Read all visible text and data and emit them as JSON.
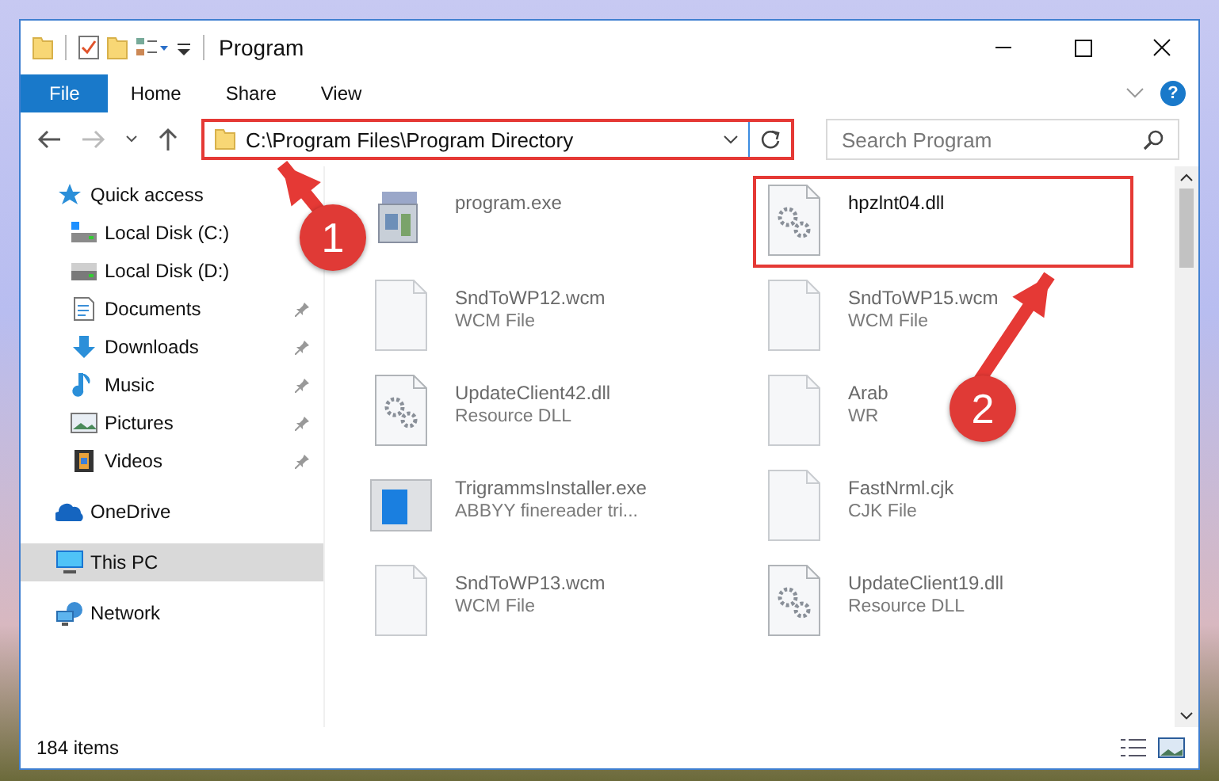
{
  "window": {
    "title": "Program"
  },
  "ribbon": {
    "tabs": [
      {
        "label": "File",
        "kind": "menu"
      },
      {
        "label": "Home",
        "kind": "tab"
      },
      {
        "label": "Share",
        "kind": "tab"
      },
      {
        "label": "View",
        "kind": "tab"
      }
    ],
    "help": "?"
  },
  "address": {
    "path": "C:\\Program Files\\Program Directory",
    "highlighted": true
  },
  "search": {
    "placeholder": "Search Program"
  },
  "sidebar": {
    "items": [
      {
        "label": "Quick access",
        "selected": false,
        "children": [
          {
            "label": "Local Disk (C:)",
            "pinned": false,
            "selected": false
          },
          {
            "label": "Local Disk (D:)",
            "pinned": false,
            "selected": false
          },
          {
            "label": "Documents",
            "pinned": true,
            "selected": false
          },
          {
            "label": "Downloads",
            "pinned": true,
            "selected": false
          },
          {
            "label": "Music",
            "pinned": true,
            "selected": false
          },
          {
            "label": "Pictures",
            "pinned": true,
            "selected": false
          },
          {
            "label": "Videos",
            "pinned": true,
            "selected": false
          }
        ]
      },
      {
        "label": "OneDrive",
        "selected": false
      },
      {
        "label": "This PC",
        "selected": true
      },
      {
        "label": "Network",
        "selected": false
      }
    ]
  },
  "files": [
    {
      "name": "program.exe",
      "kind": "exe",
      "highlighted": false
    },
    {
      "name": "hpzlnt04.dll",
      "kind": "dll",
      "highlighted": true
    },
    {
      "name": "SndToWP12.wcm",
      "type": "WCM File",
      "kind": "blank",
      "highlighted": false
    },
    {
      "name": "SndToWP15.wcm",
      "type": "WCM File",
      "kind": "blank",
      "highlighted": false
    },
    {
      "name": "UpdateClient42.dll",
      "type": "Resource DLL",
      "kind": "dll",
      "highlighted": false
    },
    {
      "name": "Arab",
      "type": "WR",
      "kind": "blank",
      "highlighted": false
    },
    {
      "name": "TrigrammsInstaller.exe",
      "type": "ABBYY finereader tri...",
      "kind": "installer",
      "highlighted": false
    },
    {
      "name": "FastNrml.cjk",
      "type": "CJK File",
      "kind": "blank",
      "highlighted": false
    },
    {
      "name": "SndToWP13.wcm",
      "type": "WCM File",
      "kind": "blank",
      "highlighted": false
    },
    {
      "name": "UpdateClient19.dll",
      "type": "Resource DLL",
      "kind": "dll",
      "highlighted": false
    }
  ],
  "annotations": [
    {
      "label": "1"
    },
    {
      "label": "2"
    }
  ],
  "status_bar": {
    "count": "184 items"
  }
}
